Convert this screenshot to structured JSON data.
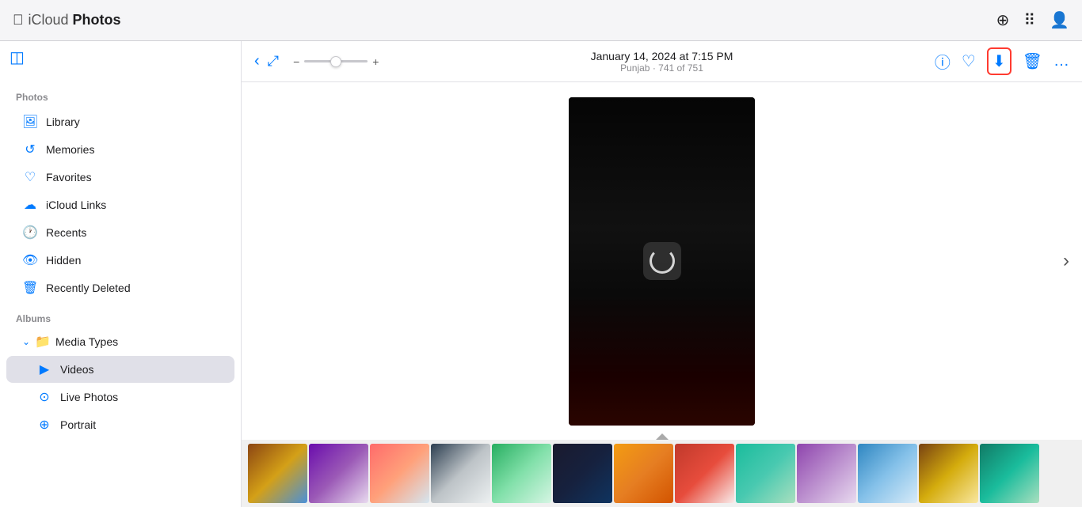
{
  "header": {
    "apple_logo": "",
    "app_name_cloud": "iCloud",
    "app_name_photos": "Photos",
    "add_icon": "⊕",
    "grid_icon": "⠿",
    "account_icon": "👤"
  },
  "sidebar": {
    "toggle_icon": "▣",
    "photos_section_title": "Photos",
    "items": [
      {
        "id": "library",
        "label": "Library",
        "icon": "🖼"
      },
      {
        "id": "memories",
        "label": "Memories",
        "icon": "↺"
      },
      {
        "id": "favorites",
        "label": "Favorites",
        "icon": "♡"
      },
      {
        "id": "icloud-links",
        "label": "iCloud Links",
        "icon": "☁"
      },
      {
        "id": "recents",
        "label": "Recents",
        "icon": "🕐"
      },
      {
        "id": "hidden",
        "label": "Hidden",
        "icon": "👁"
      },
      {
        "id": "recently-deleted",
        "label": "Recently Deleted",
        "icon": "🗑"
      }
    ],
    "albums_section_title": "Albums",
    "media_types_label": "Media Types",
    "media_types_icon": "📁",
    "sub_items": [
      {
        "id": "videos",
        "label": "Videos",
        "icon": "▶",
        "active": true
      },
      {
        "id": "live-photos",
        "label": "Live Photos",
        "icon": "⊙"
      },
      {
        "id": "portrait",
        "label": "Portrait",
        "icon": "⊕"
      }
    ]
  },
  "toolbar": {
    "back_icon": "‹",
    "expand_icon": "⤢",
    "zoom_minus": "−",
    "zoom_plus": "+",
    "date": "January 14, 2024 at 7:15 PM",
    "subtitle": "Punjab · 741 of 751",
    "info_icon": "ⓘ",
    "favorite_icon": "♡",
    "download_icon": "⬇",
    "delete_icon": "🗑",
    "more_icon": "…"
  },
  "photo": {
    "loading": true
  },
  "thumbnails": {
    "count": 13
  }
}
